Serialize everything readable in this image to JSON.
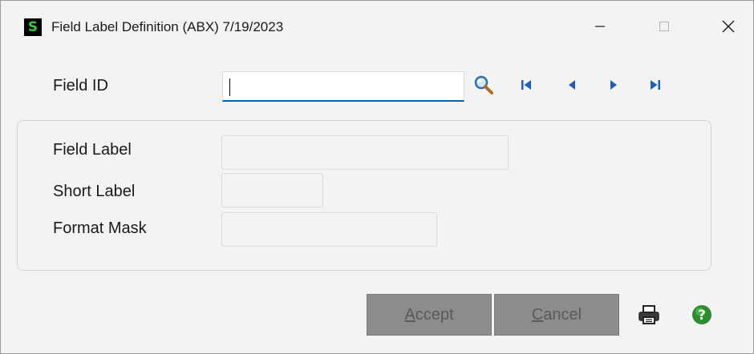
{
  "window": {
    "app_logo_text": "S",
    "title": "Field Label Definition (ABX) 7/19/2023",
    "controls": {
      "minimize": "minimize-icon",
      "maximize": "maximize-icon",
      "close": "close-icon"
    }
  },
  "form": {
    "field_id": {
      "label": "Field ID",
      "value": ""
    },
    "nav_icons": [
      "search-icon",
      "first-record-icon",
      "previous-record-icon",
      "next-record-icon",
      "last-record-icon"
    ],
    "field_label": {
      "label": "Field Label",
      "value": ""
    },
    "short_label": {
      "label": "Short Label",
      "value": ""
    },
    "format_mask": {
      "label": "Format Mask",
      "value": ""
    }
  },
  "buttons": {
    "accept_mnemonic": "A",
    "accept_rest": "ccept",
    "cancel_mnemonic": "C",
    "cancel_rest": "ancel",
    "print_icon": "printer-icon",
    "help_icon": "help-icon"
  },
  "colors": {
    "accent": "#0063b1",
    "nav_blue": "#1f5fbf",
    "disabled_button": "#8c8c8c",
    "help_green": "#2e8b2e"
  }
}
